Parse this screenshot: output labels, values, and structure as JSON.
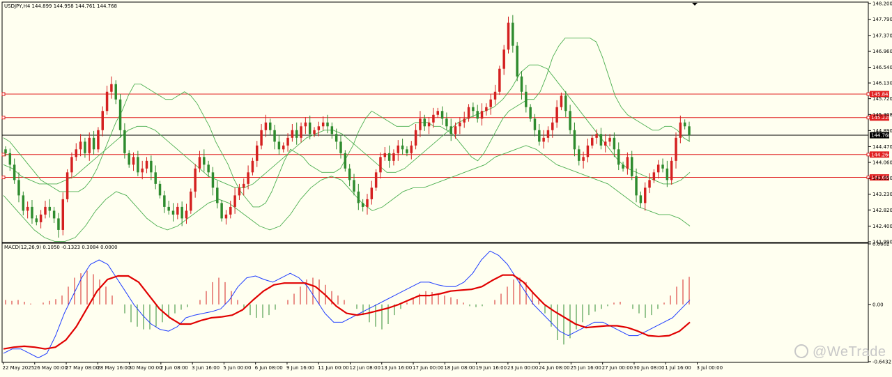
{
  "window": {
    "header": "USDJPY,H4  144.899 144.958 144.761 144.768",
    "macd_header": "MACD(12,26,9) 0.1050 -0.1323 0.3084 0.0000",
    "watermark": "@WeTrade"
  },
  "colors": {
    "background": "#fffff0",
    "bull": "#d42020",
    "bear": "#2e8b2e",
    "band": "#4caf50",
    "level": "#e02020",
    "macd_line": "#1e3cff",
    "signal_line": "#e00000"
  },
  "chart_data": [
    {
      "type": "candlestick",
      "title": "USDJPY,H4",
      "ohlc_header": [
        "144.899",
        "144.958",
        "144.761",
        "144.768"
      ],
      "ylim": [
        141.99,
        148.22
      ],
      "y_ticks": [
        "148.200",
        "147.790",
        "147.370",
        "146.960",
        "146.540",
        "146.130",
        "145.720",
        "145.308",
        "144.890",
        "144.470",
        "144.060",
        "143.650",
        "143.230",
        "142.820",
        "142.400",
        "141.990"
      ],
      "x_ticks": [
        "22 May 2025",
        "26 May 00:00",
        "27 May 08:00",
        "28 May 16:00",
        "30 May 00:00",
        "2 Jun 08:00",
        "3 Jun 16:00",
        "5 Jun 00:00",
        "6 Jun 08:00",
        "9 Jun 16:00",
        "11 Jun 00:00",
        "12 Jun 08:00",
        "13 Jun 16:00",
        "17 Jun 00:00",
        "18 Jun 08:00",
        "19 Jun 16:00",
        "23 Jun 00:00",
        "24 Jun 08:00",
        "25 Jun 16:00",
        "27 Jun 00:00",
        "30 Jun 08:00",
        "1 Jul 16:00",
        "3 Jul 00:00"
      ],
      "horizontal_levels": [
        {
          "value": 145.841,
          "label": "145.841",
          "style": "red"
        },
        {
          "value": 145.228,
          "label": "145.228",
          "style": "red"
        },
        {
          "value": 144.768,
          "label": "144.768",
          "style": "current"
        },
        {
          "value": 144.264,
          "label": "144.264",
          "style": "red"
        },
        {
          "value": 143.669,
          "label": "143.669",
          "style": "red"
        }
      ],
      "closes": [
        144.3,
        144.0,
        143.6,
        143.2,
        142.8,
        142.9,
        142.6,
        142.5,
        142.7,
        142.9,
        142.8,
        142.6,
        142.3,
        143.1,
        143.8,
        144.2,
        144.4,
        144.6,
        144.3,
        144.7,
        144.4,
        144.9,
        145.4,
        145.9,
        146.1,
        145.7,
        144.9,
        144.3,
        144.0,
        144.2,
        143.8,
        143.9,
        144.1,
        143.8,
        143.5,
        143.2,
        142.9,
        142.8,
        142.7,
        142.9,
        142.6,
        142.8,
        143.3,
        143.9,
        144.2,
        144.0,
        143.8,
        143.4,
        143.0,
        142.6,
        142.7,
        142.9,
        143.2,
        143.4,
        143.5,
        143.8,
        144.1,
        144.5,
        144.9,
        145.1,
        144.9,
        144.6,
        144.4,
        144.5,
        144.7,
        144.9,
        144.7,
        145.0,
        145.1,
        144.8,
        144.9,
        145.0,
        145.1,
        145.0,
        144.8,
        144.6,
        144.3,
        143.9,
        143.6,
        143.3,
        143.0,
        142.9,
        143.1,
        143.4,
        143.8,
        144.2,
        144.3,
        144.1,
        144.3,
        144.5,
        144.4,
        144.3,
        144.5,
        144.9,
        145.2,
        145.0,
        145.1,
        145.3,
        145.4,
        145.2,
        145.0,
        144.8,
        145.0,
        145.1,
        145.2,
        145.5,
        145.4,
        145.2,
        145.4,
        145.5,
        145.7,
        145.9,
        146.5,
        147.0,
        147.7,
        147.1,
        146.3,
        145.9,
        145.5,
        145.2,
        144.9,
        144.6,
        144.7,
        144.9,
        145.1,
        145.5,
        145.8,
        145.4,
        144.9,
        144.4,
        144.1,
        144.2,
        144.5,
        144.7,
        144.8,
        144.5,
        144.6,
        144.7,
        144.4,
        144.0,
        143.9,
        144.2,
        143.7,
        143.2,
        143.0,
        143.4,
        143.6,
        143.8,
        144.0,
        143.9,
        143.6,
        144.1,
        144.7,
        145.1,
        145.0,
        144.768
      ],
      "bands": {
        "upper": [
          144.7,
          144.6,
          144.4,
          144.2,
          144.0,
          143.8,
          143.6,
          143.5,
          143.4,
          143.3,
          143.3,
          143.3,
          143.3,
          143.4,
          143.6,
          143.9,
          144.3,
          144.7,
          145.1,
          145.4,
          145.8,
          146.1,
          146.1,
          146.0,
          145.9,
          145.8,
          145.7,
          145.7,
          145.8,
          145.9,
          145.8,
          145.6,
          145.3,
          145.0,
          144.6,
          144.3,
          144.0,
          143.6,
          143.3,
          143.1,
          142.9,
          142.9,
          143.0,
          143.3,
          143.7,
          144.1,
          144.4,
          144.3,
          144.2,
          144.0,
          143.9,
          143.8,
          143.8,
          143.8,
          143.9,
          144.2,
          144.5,
          144.9,
          145.2,
          145.4,
          145.3,
          145.2,
          145.1,
          145.0,
          145.0,
          145.0,
          145.1,
          145.1,
          145.1,
          145.0,
          145.0,
          144.9,
          144.8,
          144.6,
          144.4,
          144.2,
          144.1,
          144.3,
          144.6,
          144.9,
          145.2,
          145.4,
          145.5,
          145.6,
          145.7,
          145.7,
          145.9,
          146.3,
          146.8,
          147.1,
          147.3,
          147.3,
          147.3,
          147.3,
          147.3,
          147.2,
          146.8,
          146.3,
          145.8,
          145.5,
          145.3,
          145.2,
          145.1,
          145.0,
          144.9,
          144.9,
          145.0,
          145.0,
          144.9,
          144.7,
          144.6
        ],
        "middle": [
          144.0,
          143.9,
          143.7,
          143.6,
          143.5,
          143.5,
          143.5,
          143.6,
          143.7,
          143.9,
          144.1,
          144.3,
          144.5,
          144.7,
          144.9,
          145.0,
          145.0,
          144.9,
          144.7,
          144.5,
          144.3,
          144.1,
          143.9,
          143.7,
          143.6,
          143.5,
          143.4,
          143.4,
          143.5,
          143.7,
          143.9,
          144.1,
          144.3,
          144.5,
          144.7,
          144.8,
          144.9,
          144.9,
          144.8,
          144.6,
          144.4,
          144.2,
          144.0,
          143.8,
          143.8,
          143.9,
          144.1,
          144.3,
          144.5,
          144.7,
          144.9,
          145.1,
          145.2,
          145.3,
          145.4,
          145.5,
          145.7,
          146.0,
          146.4,
          146.6,
          146.6,
          146.5,
          146.2,
          145.9,
          145.6,
          145.3,
          145.0,
          144.7,
          144.4,
          144.1,
          143.9,
          143.8,
          143.7,
          143.6,
          143.5,
          143.5,
          143.6,
          143.8
        ],
        "lower": [
          143.2,
          142.9,
          142.6,
          142.3,
          142.1,
          142.0,
          142.0,
          142.1,
          142.4,
          142.8,
          143.1,
          143.3,
          143.2,
          142.9,
          142.6,
          142.4,
          142.3,
          142.4,
          142.6,
          142.8,
          143.0,
          143.1,
          143.0,
          142.8,
          142.6,
          142.4,
          142.3,
          142.4,
          142.7,
          143.1,
          143.4,
          143.6,
          143.7,
          143.6,
          143.3,
          143.0,
          142.8,
          142.9,
          143.1,
          143.3,
          143.4,
          143.4,
          143.5,
          143.6,
          143.7,
          143.8,
          143.9,
          144.0,
          144.2,
          144.3,
          144.4,
          144.5,
          144.4,
          144.2,
          144.0,
          143.9,
          143.8,
          143.7,
          143.6,
          143.5,
          143.3,
          143.1,
          142.9,
          142.8,
          142.7,
          142.7,
          142.6,
          142.4
        ]
      }
    },
    {
      "type": "macd",
      "title": "MACD(12,26,9)",
      "params": [
        12,
        26,
        9
      ],
      "values_header": [
        "0.1050",
        "-0.1323",
        "0.3084",
        "0.0000"
      ],
      "ylim": [
        -0.6432,
        0.6802
      ],
      "y_ticks": [
        "0.6802",
        "0.00",
        "-0.6432"
      ],
      "histogram": [
        0.05,
        0.04,
        0.05,
        0.03,
        0.01,
        0.0,
        0.02,
        0.04,
        0.06,
        0.1,
        0.2,
        0.3,
        0.35,
        0.38,
        0.34,
        0.28,
        0.2,
        0.1,
        0.0,
        -0.1,
        -0.2,
        -0.25,
        -0.28,
        -0.28,
        -0.25,
        -0.2,
        -0.15,
        -0.1,
        -0.06,
        -0.03,
        0.0,
        0.05,
        0.15,
        0.25,
        0.3,
        0.25,
        0.15,
        0.05,
        -0.05,
        -0.12,
        -0.15,
        -0.15,
        -0.12,
        -0.06,
        0.0,
        0.05,
        0.12,
        0.2,
        0.28,
        0.3,
        0.28,
        0.22,
        0.15,
        0.1,
        0.05,
        0.0,
        -0.05,
        -0.12,
        -0.2,
        -0.25,
        -0.28,
        -0.22,
        -0.12,
        -0.05,
        0.02,
        0.08,
        0.12,
        0.15,
        0.14,
        0.12,
        0.1,
        0.08,
        0.06,
        0.02,
        -0.02,
        -0.03,
        -0.02,
        0.0,
        0.05,
        0.12,
        0.2,
        0.28,
        0.3,
        0.25,
        0.15,
        0.05,
        -0.1,
        -0.25,
        -0.4,
        -0.45,
        -0.38,
        -0.28,
        -0.2,
        -0.12,
        -0.08,
        -0.05,
        -0.02,
        0.02,
        0.03,
        0.0,
        -0.05,
        -0.1,
        -0.15,
        -0.12,
        -0.05,
        0.02,
        0.1,
        0.2,
        0.28,
        0.31
      ],
      "macd": [
        -0.55,
        -0.5,
        -0.5,
        -0.55,
        -0.6,
        -0.55,
        -0.35,
        -0.1,
        0.1,
        0.3,
        0.45,
        0.5,
        0.45,
        0.3,
        0.15,
        0.0,
        -0.12,
        -0.22,
        -0.28,
        -0.3,
        -0.25,
        -0.15,
        -0.12,
        -0.1,
        -0.08,
        -0.05,
        0.05,
        0.2,
        0.3,
        0.32,
        0.28,
        0.25,
        0.3,
        0.35,
        0.3,
        0.2,
        0.05,
        -0.1,
        -0.2,
        -0.2,
        -0.15,
        -0.1,
        -0.05,
        0.0,
        0.05,
        0.1,
        0.15,
        0.2,
        0.25,
        0.25,
        0.22,
        0.2,
        0.2,
        0.25,
        0.35,
        0.5,
        0.6,
        0.55,
        0.45,
        0.3,
        0.15,
        0.0,
        -0.1,
        -0.2,
        -0.3,
        -0.35,
        -0.3,
        -0.25,
        -0.2,
        -0.2,
        -0.25,
        -0.3,
        -0.35,
        -0.35,
        -0.3,
        -0.25,
        -0.2,
        -0.15,
        -0.05,
        0.05
      ],
      "signal": [
        -0.5,
        -0.48,
        -0.47,
        -0.48,
        -0.5,
        -0.48,
        -0.4,
        -0.25,
        -0.05,
        0.15,
        0.28,
        0.32,
        0.32,
        0.25,
        0.1,
        -0.05,
        -0.15,
        -0.22,
        -0.22,
        -0.18,
        -0.15,
        -0.14,
        -0.12,
        -0.06,
        0.05,
        0.15,
        0.22,
        0.24,
        0.24,
        0.24,
        0.2,
        0.1,
        -0.02,
        -0.1,
        -0.12,
        -0.1,
        -0.07,
        -0.04,
        0.0,
        0.05,
        0.1,
        0.1,
        0.12,
        0.15,
        0.16,
        0.17,
        0.2,
        0.27,
        0.33,
        0.33,
        0.25,
        0.12,
        0.0,
        -0.08,
        -0.15,
        -0.22,
        -0.26,
        -0.25,
        -0.24,
        -0.24,
        -0.26,
        -0.3,
        -0.35,
        -0.36,
        -0.35,
        -0.3,
        -0.2
      ]
    }
  ]
}
